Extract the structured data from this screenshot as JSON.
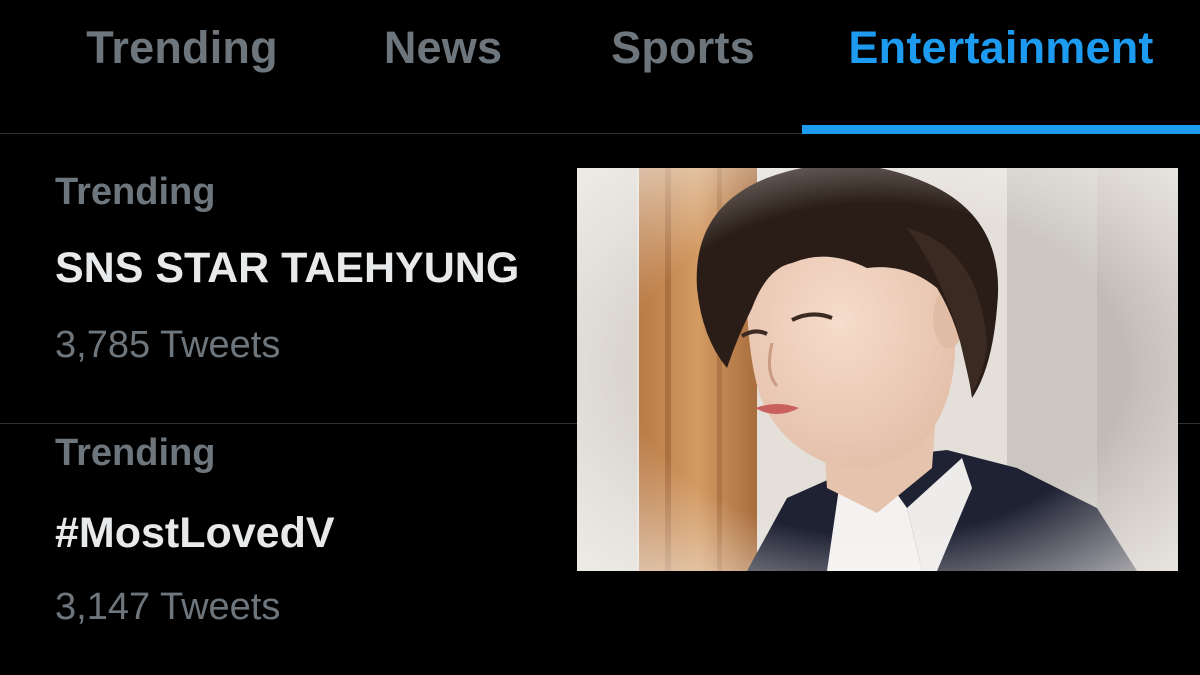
{
  "tabs": [
    {
      "label": ""
    },
    {
      "label": "Trending"
    },
    {
      "label": "News"
    },
    {
      "label": "Sports"
    },
    {
      "label": "Entertainment",
      "active": true
    }
  ],
  "colors": {
    "accent": "#1d9bf0",
    "muted_text": "#6e767d",
    "primary_text": "#e7e9ea",
    "divider": "#2f3336",
    "background": "#000000"
  },
  "trends": [
    {
      "context": "Trending",
      "name": "SNS STAR TAEHYUNG",
      "count": "3,785 Tweets"
    },
    {
      "context": "Trending",
      "name": "#MostLovedV",
      "count": "3,147 Tweets"
    }
  ],
  "media": {
    "icon": "trend-photo-image"
  }
}
